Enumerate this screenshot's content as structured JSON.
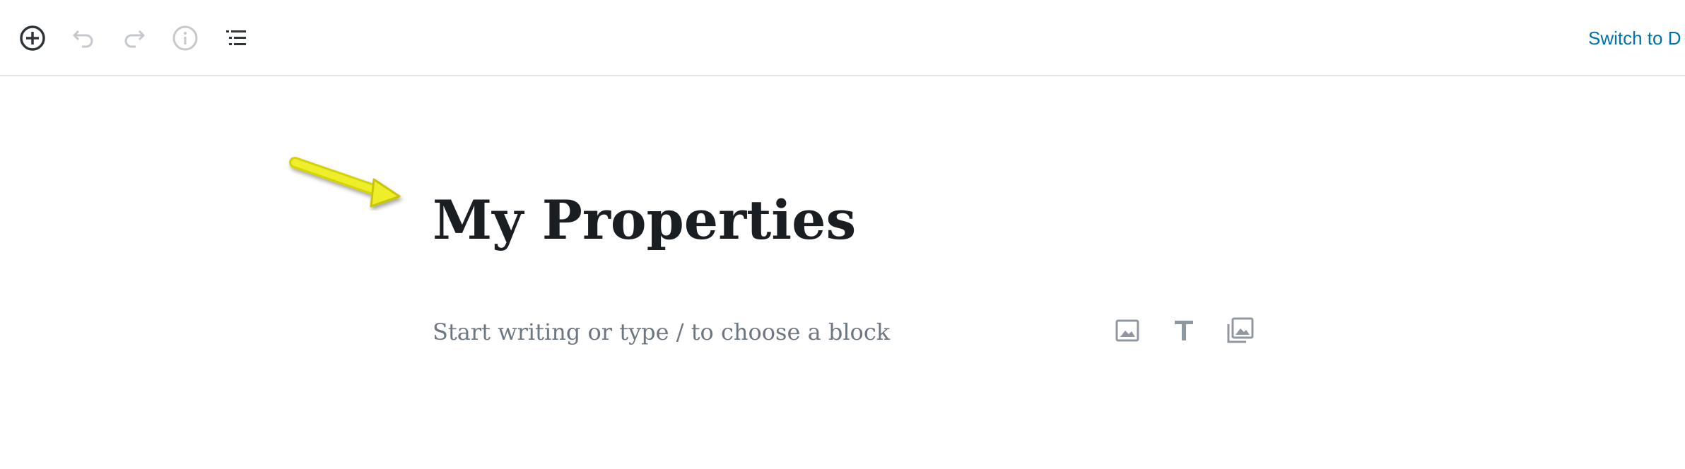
{
  "toolbar": {
    "items": [
      {
        "name": "add-block",
        "icon": "plus-circle-icon",
        "enabled": true
      },
      {
        "name": "undo",
        "icon": "undo-icon",
        "enabled": false
      },
      {
        "name": "redo",
        "icon": "redo-icon",
        "enabled": false
      },
      {
        "name": "content-structure",
        "icon": "info-icon",
        "enabled": false
      },
      {
        "name": "block-navigation",
        "icon": "list-icon",
        "enabled": true
      }
    ],
    "switch_label": "Switch to D"
  },
  "editor": {
    "title": "My Properties",
    "placeholder": "Start writing or type / to choose a block",
    "inserter_shortcuts": [
      {
        "name": "image",
        "icon": "image-icon"
      },
      {
        "name": "heading",
        "icon": "heading-icon"
      },
      {
        "name": "gallery",
        "icon": "gallery-icon"
      }
    ]
  },
  "annotation": {
    "icon": "arrow-icon",
    "color": "#e8e81a"
  },
  "colors": {
    "text": "#191e23",
    "muted": "#6c7781",
    "link": "#0073aa",
    "disabled_icon": "#c5c9cd",
    "border": "#e2e4e7"
  }
}
